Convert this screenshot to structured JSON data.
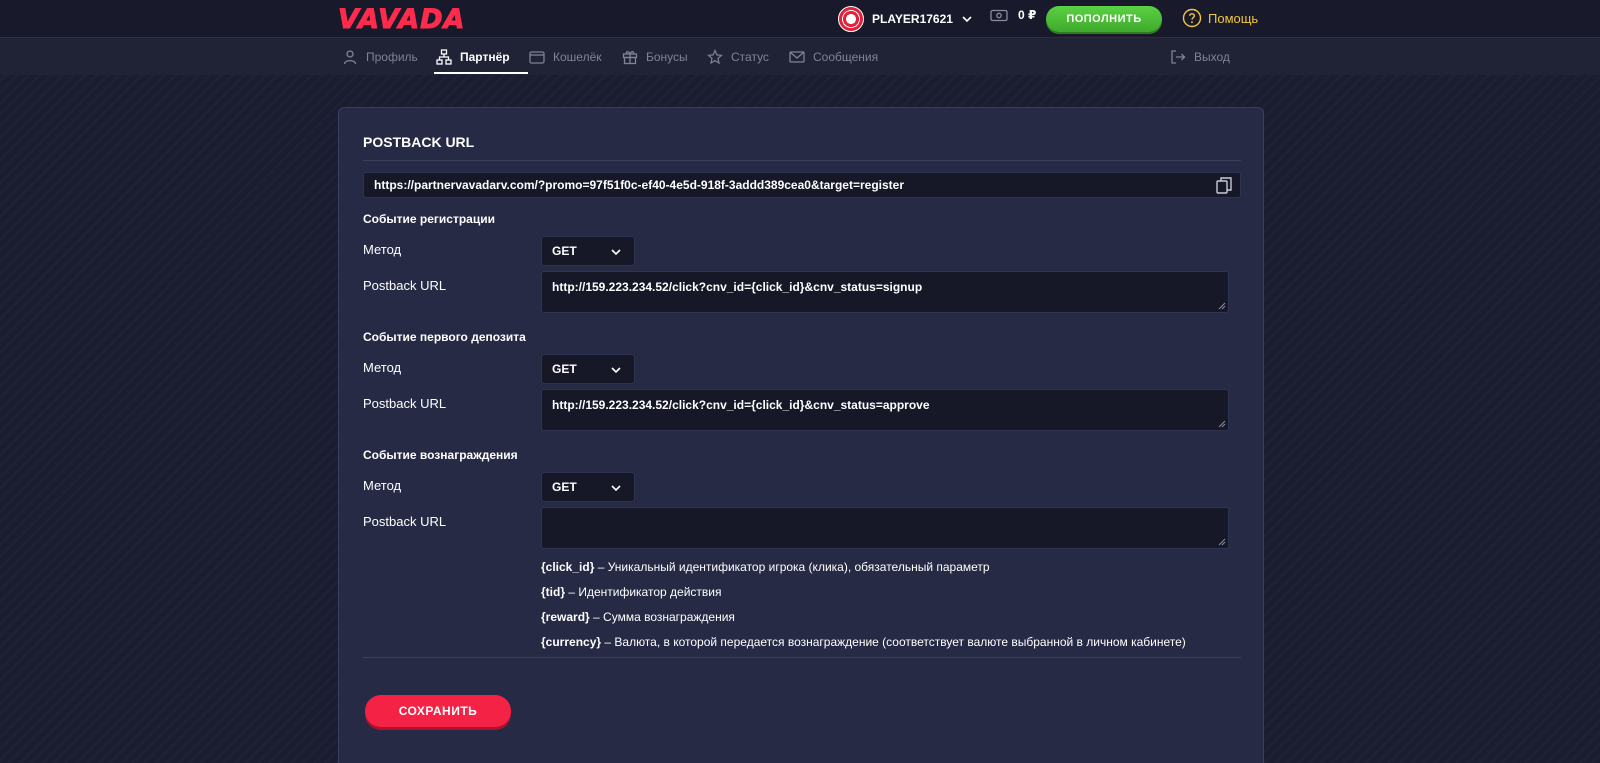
{
  "header": {
    "logo": "VAVADA",
    "username": "PLAYER17621",
    "balance": "0 ₽",
    "deposit_label": "ПОПОЛНИТЬ",
    "help_label": "Помощь",
    "colors": {
      "brand": "#ff2b4c",
      "deposit": "#4cbd36",
      "help": "#f2c73c"
    }
  },
  "nav": {
    "items": [
      {
        "label": "Профиль",
        "icon": "user-icon"
      },
      {
        "label": "Партнёр",
        "icon": "partner-icon",
        "active": true
      },
      {
        "label": "Кошелёк",
        "icon": "wallet-icon"
      },
      {
        "label": "Бонусы",
        "icon": "gift-icon"
      },
      {
        "label": "Статус",
        "icon": "star-icon"
      },
      {
        "label": "Сообщения",
        "icon": "envelope-icon"
      }
    ],
    "logout_label": "Выход"
  },
  "card": {
    "title": "POSTBACK URL",
    "partner_url": "https://partnervavadarv.com/?promo=97f51f0c-ef40-4e5d-918f-3addd389cea0&target=register",
    "method_label": "Метод",
    "postback_label": "Postback URL",
    "sections": [
      {
        "title": "Событие регистрации",
        "method": "GET",
        "postback_url": "http://159.223.234.52/click?cnv_id={click_id}&cnv_status=signup"
      },
      {
        "title": "Событие первого депозита",
        "method": "GET",
        "postback_url": "http://159.223.234.52/click?cnv_id={click_id}&cnv_status=approve"
      },
      {
        "title": "Событие вознаграждения",
        "method": "GET",
        "postback_url": ""
      }
    ],
    "params": [
      {
        "key": "{click_id}",
        "desc": " – Уникальный идентификатор игрока (клика), обязательный параметр"
      },
      {
        "key": "{tid}",
        "desc": " – Идентификатор действия"
      },
      {
        "key": "{reward}",
        "desc": " – Сумма вознаграждения"
      },
      {
        "key": "{currency}",
        "desc": " – Валюта, в которой передается вознаграждение (соответствует валюте выбранной в личном кабинете)"
      }
    ],
    "save_label": "СОХРАНИТЬ"
  }
}
